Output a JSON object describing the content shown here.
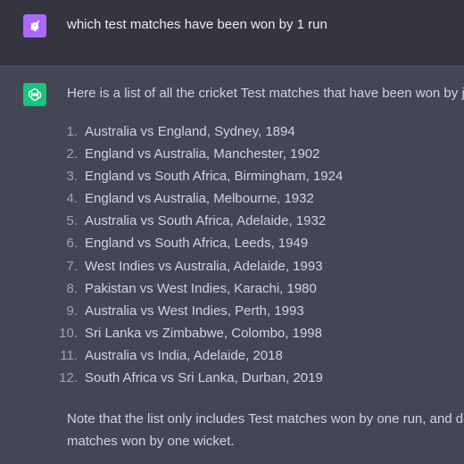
{
  "user": {
    "message": "which test matches have been won by 1 run"
  },
  "assistant": {
    "intro": "Here is a list of all the cricket Test matches that have been won by ju",
    "matches": [
      {
        "num": "1.",
        "label": "Australia vs England, Sydney, 1894"
      },
      {
        "num": "2.",
        "label": "England vs Australia, Manchester, 1902"
      },
      {
        "num": "3.",
        "label": "England vs South Africa, Birmingham, 1924"
      },
      {
        "num": "4.",
        "label": "England vs Australia, Melbourne, 1932"
      },
      {
        "num": "5.",
        "label": "Australia vs South Africa, Adelaide, 1932"
      },
      {
        "num": "6.",
        "label": "England vs South Africa, Leeds, 1949"
      },
      {
        "num": "7.",
        "label": "West Indies vs Australia, Adelaide, 1993"
      },
      {
        "num": "8.",
        "label": "Pakistan vs West Indies, Karachi, 1980"
      },
      {
        "num": "9.",
        "label": "Australia vs West Indies, Perth, 1993"
      },
      {
        "num": "10.",
        "label": "Sri Lanka vs Zimbabwe, Colombo, 1998"
      },
      {
        "num": "11.",
        "label": "Australia vs India, Adelaide, 2018"
      },
      {
        "num": "12.",
        "label": "South Africa vs Sri Lanka, Durban, 2019"
      }
    ],
    "note_line1": "Note that the list only includes Test matches won by one run, and do",
    "note_line2": "matches won by one wicket."
  },
  "icons": {
    "user_avatar": "user-avatar-icon",
    "assistant_avatar": "openai-logo-icon"
  },
  "colors": {
    "user_bg": "#343541",
    "assistant_bg": "#444654",
    "user_avatar": "#ab68ff",
    "assistant_avatar": "#19c37d"
  }
}
